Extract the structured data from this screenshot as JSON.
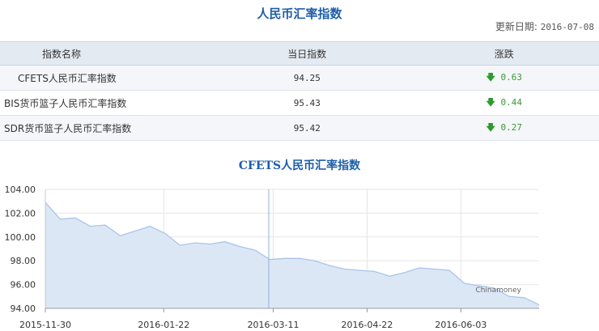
{
  "header": {
    "title": "人民币汇率指数",
    "update_label": "更新日期:",
    "update_date": "2016-07-08"
  },
  "table": {
    "columns": [
      "指数名称",
      "当日指数",
      "涨跌"
    ],
    "rows": [
      {
        "name": "CFETS人民币汇率指数",
        "value": "94.25",
        "change": "0.63",
        "direction": "down"
      },
      {
        "name": "BIS货币篮子人民币汇率指数",
        "value": "95.43",
        "change": "0.44",
        "direction": "down"
      },
      {
        "name": "SDR货币篮子人民币汇率指数",
        "value": "95.42",
        "change": "0.27",
        "direction": "down"
      }
    ],
    "down_arrow": "🡇",
    "change_color": "#3a9a3a"
  },
  "chart_title": "CFETS人民币汇率指数",
  "chart_data": {
    "type": "area",
    "title": "CFETS人民币汇率指数",
    "x": [
      "2015-11-30",
      "2015-12-11",
      "2015-12-18",
      "2015-12-25",
      "2015-12-31",
      "2016-01-08",
      "2016-01-15",
      "2016-01-22",
      "2016-01-29",
      "2016-02-05",
      "2016-02-12",
      "2016-02-19",
      "2016-02-26",
      "2016-03-04",
      "2016-03-11",
      "2016-03-18",
      "2016-03-25",
      "2016-04-01",
      "2016-04-08",
      "2016-04-15",
      "2016-04-22",
      "2016-04-29",
      "2016-05-06",
      "2016-05-13",
      "2016-05-20",
      "2016-05-27",
      "2016-06-03",
      "2016-06-10",
      "2016-06-17",
      "2016-06-24",
      "2016-07-01",
      "2016-07-08"
    ],
    "values": [
      102.9,
      101.5,
      101.6,
      100.9,
      101.0,
      100.1,
      100.5,
      100.9,
      100.3,
      99.3,
      99.5,
      99.4,
      99.6,
      99.2,
      98.9,
      98.1,
      98.2,
      98.2,
      98.0,
      97.6,
      97.3,
      97.2,
      97.1,
      96.7,
      97.0,
      97.4,
      97.3,
      97.2,
      96.1,
      95.9,
      95.7,
      95.0,
      94.9,
      94.3
    ],
    "x_ticks": [
      "2015-11-30",
      "2016-01-22",
      "2016-03-11",
      "2016-04-22",
      "2016-06-03"
    ],
    "y_ticks": [
      "94.00",
      "96.00",
      "98.00",
      "100.00",
      "102.00",
      "104.00"
    ],
    "ylim": [
      94,
      104
    ],
    "crosshair_at": "2016-03-09",
    "credit": "Chinamoney",
    "fill_color": "#dce7f6",
    "line_color": "#a9c4e8",
    "grid": true
  }
}
